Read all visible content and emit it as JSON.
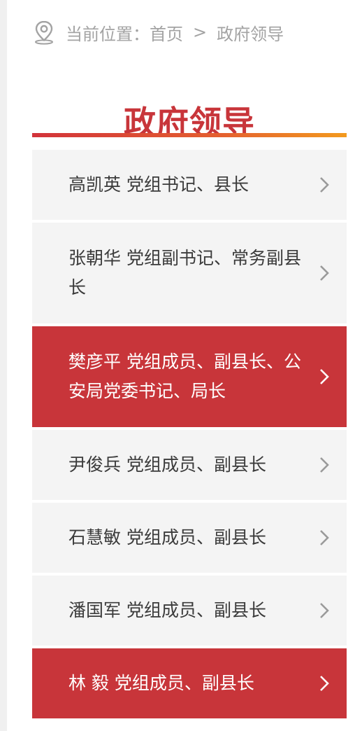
{
  "breadcrumb": {
    "location_label": "当前位置：",
    "home": "首页",
    "separator": ">",
    "current": "政府领导"
  },
  "page_title": "政府领导",
  "colors": {
    "accent": "#c8353a",
    "gradient_end": "#f39a1e",
    "item_background": "#f4f4f4",
    "text": "#3b3b3b",
    "muted": "#a3a3a3"
  },
  "icons": {
    "location": "location-pin-icon",
    "chevron": "chevron-right-icon"
  },
  "leaders": [
    {
      "label": "高凯英 党组书记、县长",
      "active": false
    },
    {
      "label": "张朝华 党组副书记、常务副县长",
      "active": false
    },
    {
      "label": "樊彦平 党组成员、副县长、公安局党委书记、局长",
      "active": true
    },
    {
      "label": "尹俊兵 党组成员、副县长",
      "active": false
    },
    {
      "label": "石慧敏 党组成员、副县长",
      "active": false
    },
    {
      "label": "潘国军 党组成员、副县长",
      "active": false
    },
    {
      "label": "林 毅 党组成员、副县长",
      "active": true
    }
  ]
}
